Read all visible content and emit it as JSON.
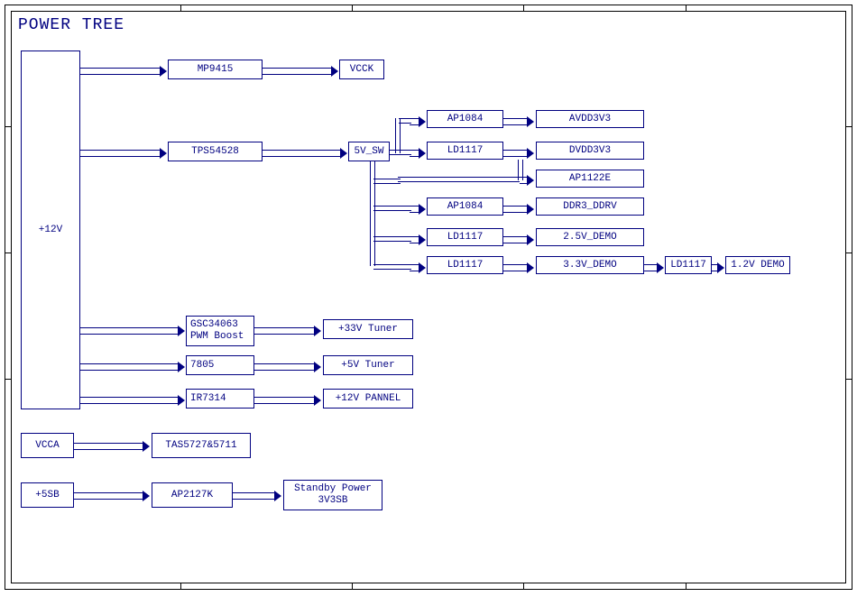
{
  "title": "POWER TREE",
  "blocks": {
    "input_12v": "+12V",
    "mp9415": "MP9415",
    "vcck": "VCCK",
    "tps54528": "TPS54528",
    "sw5v": "5V_SW",
    "ap1084_a": "AP1084",
    "avdd3v3": "AVDD3V3",
    "ld1117_a": "LD1117",
    "dvdd3v3": "DVDD3V3",
    "ap1122e": "AP1122E",
    "ap1084_b": "AP1084",
    "ddr3_ddrv": "DDR3_DDRV",
    "ld1117_b": "LD1117",
    "demo_2v5": "2.5V_DEMO",
    "ld1117_c": "LD1117",
    "demo_3v3": "3.3V_DEMO",
    "ld1117_d": "LD1117",
    "demo_1v2": "1.2V DEMO",
    "gsc34063": "GSC34063 PWM Boost",
    "tuner_33v": "+33V Tuner",
    "reg_7805": "7805",
    "tuner_5v": "+5V Tuner",
    "ir7314": "IR7314",
    "panel_12v": "+12V PANNEL",
    "vcca": "VCCA",
    "tas5727": "TAS5727&5711",
    "sb5": "+5SB",
    "ap2127k": "AP2127K",
    "standby": "Standby Power 3V3SB"
  }
}
